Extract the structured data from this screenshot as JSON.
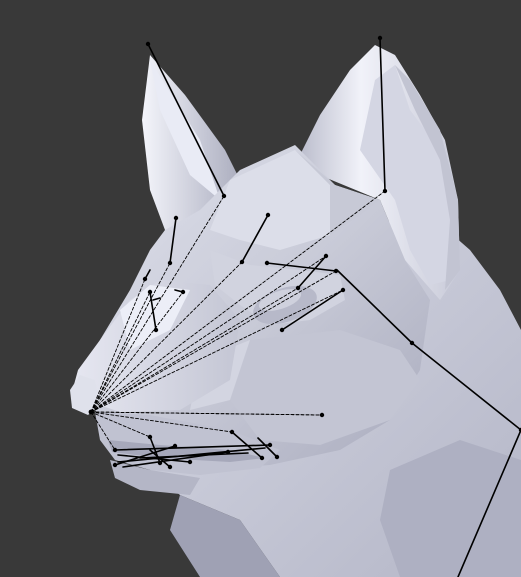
{
  "viewport": {
    "background_color": "#393939",
    "mesh_base_color": "#c8c9d6",
    "mesh_highlight_color": "#eef0fa",
    "mesh_shadow_color": "#9a9caf",
    "bone_color": "#000000"
  }
}
